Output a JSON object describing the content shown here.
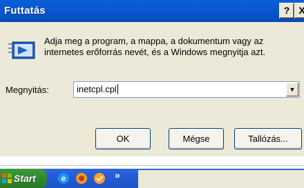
{
  "dialog": {
    "title": "Futtatás",
    "help_button": "?",
    "close_button": "X",
    "description": "Adja meg a program, a mappa, a dokumentum vagy az internetes erőforrás nevét, és a Windows megnyitja azt.",
    "open_label": "Megnyitás:",
    "input_value": "inetcpl.cpl",
    "ok_label": "OK",
    "cancel_label": "Mégse",
    "browse_label": "Tallózás..."
  },
  "taskbar": {
    "start_label": "Start",
    "more_label": "»",
    "quick_launch": [
      "ie-icon",
      "media-player-icon",
      "desktop-icon"
    ]
  }
}
